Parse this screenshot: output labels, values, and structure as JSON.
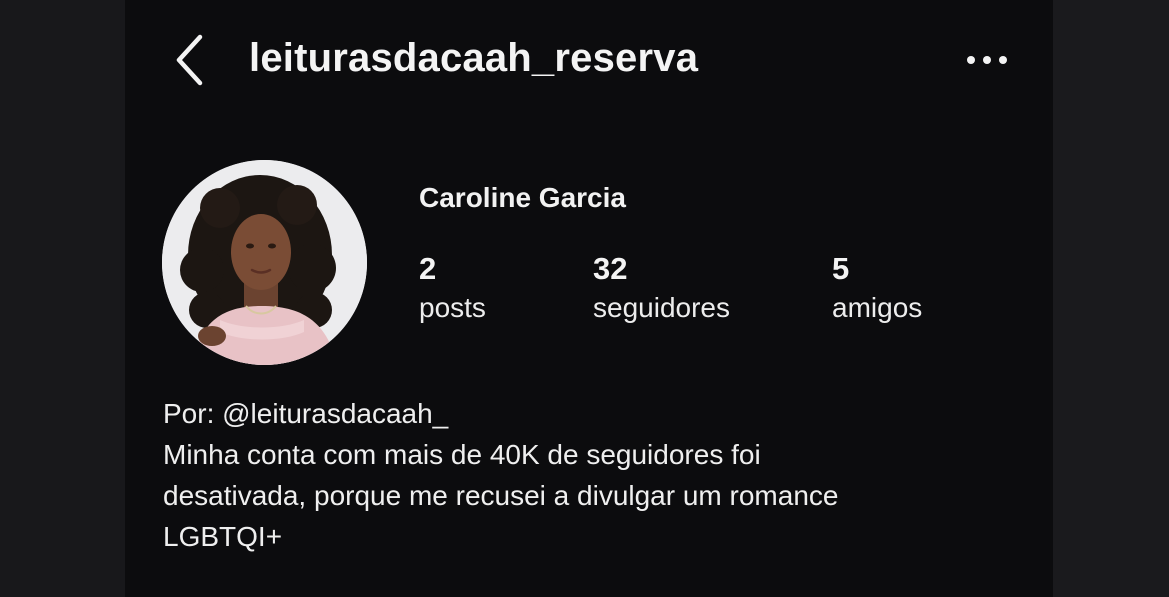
{
  "header": {
    "username": "leiturasdacaah_reserva",
    "back_icon": "chevron-left-icon",
    "more_icon": "more-horizontal-icon"
  },
  "profile": {
    "display_name": "Caroline Garcia",
    "stats": {
      "posts": {
        "value": "2",
        "label": "posts"
      },
      "followers": {
        "value": "32",
        "label": "seguidores"
      },
      "friends": {
        "value": "5",
        "label": "amigos"
      }
    },
    "bio": {
      "line1": "Por: @leiturasdacaah_",
      "line2": "Minha conta com mais de 40K de seguidores foi",
      "line3": "desativada, porque me recusei a divulgar um romance",
      "line4": "LGBTQI+"
    }
  },
  "colors": {
    "background": "#0c0c0e",
    "text": "#f5f5f5",
    "avatar_bg": "#ececee"
  }
}
